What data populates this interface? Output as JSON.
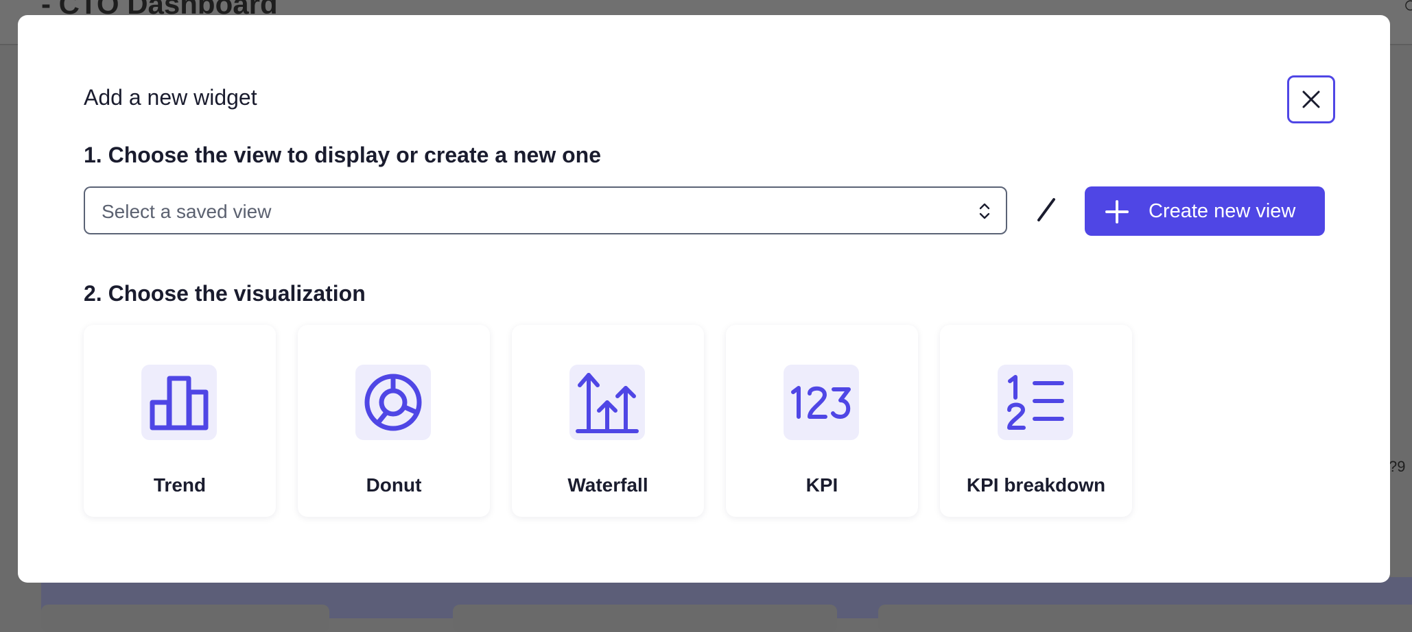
{
  "background": {
    "page_title": "- CTO Dashboard"
  },
  "modal": {
    "title": "Add a new widget",
    "close_icon": "close-icon",
    "step1": {
      "heading": "1. Choose the view to display or create a new one",
      "select_placeholder": "Select a saved view",
      "divider": "/",
      "create_button_label": "Create new view",
      "create_button_icon": "plus-icon"
    },
    "step2": {
      "heading": "2. Choose the visualization",
      "options": [
        {
          "label": "Trend",
          "icon": "bar-chart-icon"
        },
        {
          "label": "Donut",
          "icon": "donut-chart-icon"
        },
        {
          "label": "Waterfall",
          "icon": "waterfall-icon"
        },
        {
          "label": "KPI",
          "icon": "kpi-123-icon"
        },
        {
          "label": "KPI breakdown",
          "icon": "numbered-list-icon"
        }
      ]
    }
  },
  "colors": {
    "accent": "#4f46e5",
    "icon_tile": "#eeedfc",
    "text": "#1a1c2e",
    "overlay": "#6b6b6b"
  }
}
